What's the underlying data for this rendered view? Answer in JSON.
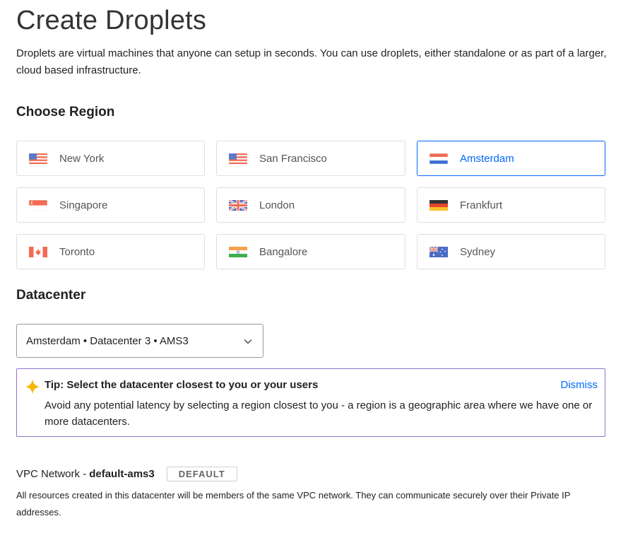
{
  "page": {
    "title": "Create Droplets",
    "intro": "Droplets are virtual machines that anyone can setup in seconds. You can use droplets, either standalone or as part of a larger, cloud based infrastructure."
  },
  "region_section": {
    "heading": "Choose Region",
    "selected": "Amsterdam",
    "regions": [
      {
        "label": "New York",
        "flag_icon": "us-flag-icon"
      },
      {
        "label": "San Francisco",
        "flag_icon": "us-flag-icon"
      },
      {
        "label": "Amsterdam",
        "flag_icon": "netherlands-flag-icon"
      },
      {
        "label": "Singapore",
        "flag_icon": "singapore-flag-icon"
      },
      {
        "label": "London",
        "flag_icon": "uk-flag-icon"
      },
      {
        "label": "Frankfurt",
        "flag_icon": "germany-flag-icon"
      },
      {
        "label": "Toronto",
        "flag_icon": "canada-flag-icon"
      },
      {
        "label": "Bangalore",
        "flag_icon": "india-flag-icon"
      },
      {
        "label": "Sydney",
        "flag_icon": "australia-flag-icon"
      }
    ]
  },
  "datacenter_section": {
    "heading": "Datacenter",
    "selected_value": "Amsterdam • Datacenter 3 • AMS3"
  },
  "tip": {
    "title": "Tip: Select the datacenter closest to you or your users",
    "body": "Avoid any potential latency by selecting a region closest to you - a region is a geographic area where we have one or more datacenters.",
    "dismiss_label": "Dismiss"
  },
  "vpc": {
    "label": "VPC Network -",
    "name": "default-ams3",
    "badge": "DEFAULT",
    "description": "All resources created in this datacenter will be members of the same VPC network. They can communicate securely over their Private IP addresses."
  },
  "colors": {
    "accent": "#0069ff",
    "tip_border": "#8f74c9",
    "card_border": "#dfdfdf"
  }
}
